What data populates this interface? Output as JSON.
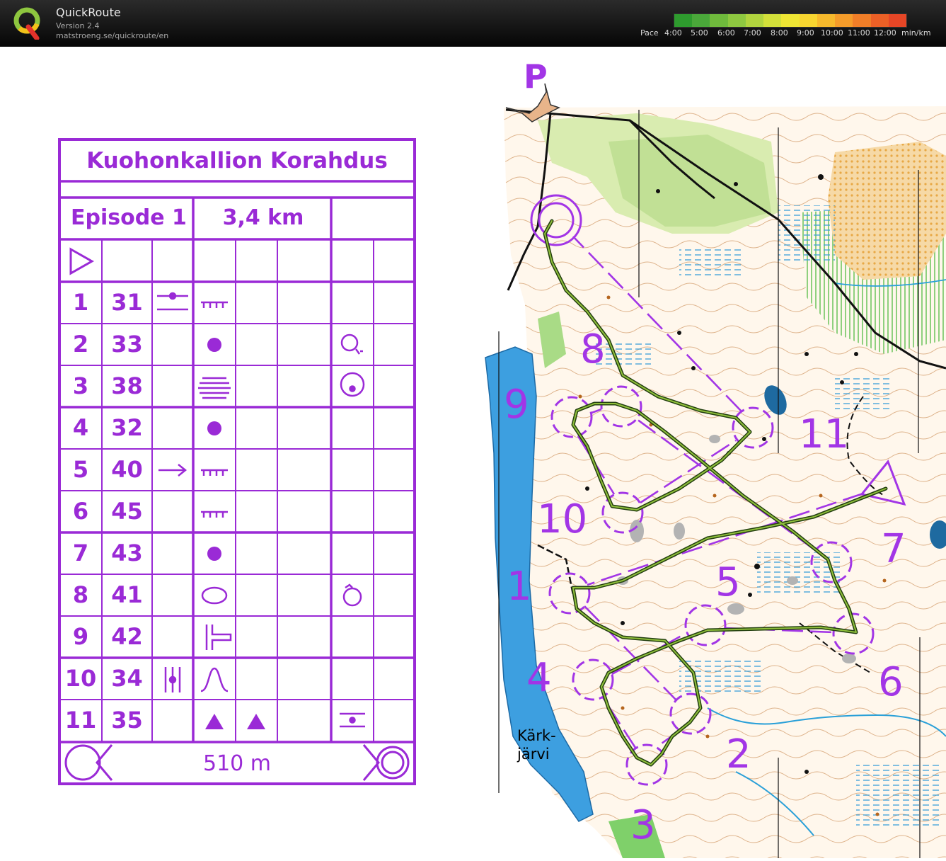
{
  "app": {
    "name": "QuickRoute",
    "version": "Version 2.4",
    "url": "matstroeng.se/quickroute/en"
  },
  "pace_legend": {
    "label": "Pace",
    "ticks": [
      "4:00",
      "5:00",
      "6:00",
      "7:00",
      "8:00",
      "9:00",
      "10:00",
      "11:00",
      "12:00"
    ],
    "unit": "min/km",
    "colors": [
      "#2e9b2e",
      "#4aa83a",
      "#6fba3c",
      "#8ec840",
      "#b1d43e",
      "#d3e03a",
      "#efe634",
      "#f7d530",
      "#f6b92c",
      "#f49c2a",
      "#f07e28",
      "#ec6026",
      "#e64626"
    ]
  },
  "control_description": {
    "event_name": "Kuohonkallion Korahdus",
    "course": "Episode 1",
    "length": "3,4 km",
    "controls": [
      {
        "num": "1",
        "code": "31"
      },
      {
        "num": "2",
        "code": "33"
      },
      {
        "num": "3",
        "code": "38"
      },
      {
        "num": "4",
        "code": "32"
      },
      {
        "num": "5",
        "code": "40"
      },
      {
        "num": "6",
        "code": "45"
      },
      {
        "num": "7",
        "code": "43"
      },
      {
        "num": "8",
        "code": "41"
      },
      {
        "num": "9",
        "code": "42"
      },
      {
        "num": "10",
        "code": "34"
      },
      {
        "num": "11",
        "code": "35"
      }
    ],
    "finish_distance": "510 m"
  },
  "map": {
    "parking_label": "P",
    "lake_label": "Kärk-\njärvi",
    "control_numbers": [
      {
        "label": "1"
      },
      {
        "label": "2"
      },
      {
        "label": "3"
      },
      {
        "label": "4"
      },
      {
        "label": "5"
      },
      {
        "label": "6"
      },
      {
        "label": "7"
      },
      {
        "label": "8"
      },
      {
        "label": "9"
      },
      {
        "label": "10"
      },
      {
        "label": "11"
      }
    ],
    "colors": {
      "course": "#a235e6",
      "route": "#3c6e1e",
      "water": "#3d9fe0",
      "contour": "#b5651d",
      "open": "#f3cc8a",
      "green": "#9bd27a",
      "paper": "#fff7ec"
    }
  }
}
